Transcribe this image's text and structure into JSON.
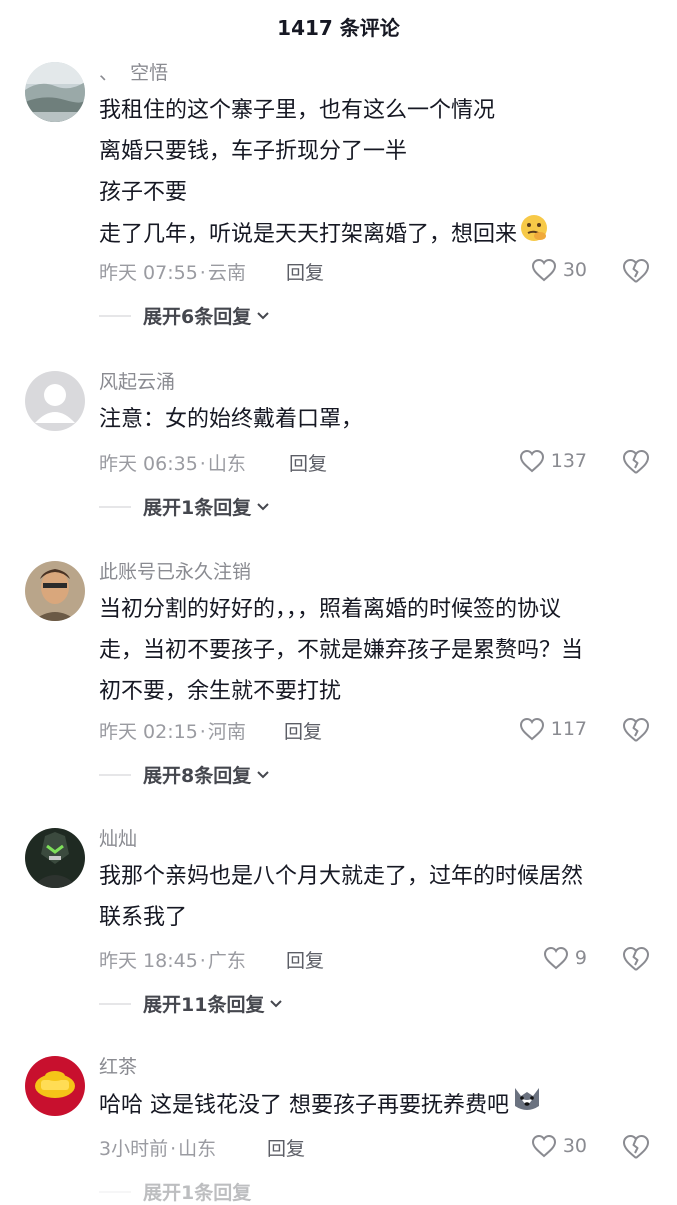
{
  "header": {
    "title": "1417 条评论"
  },
  "comments": [
    {
      "username": "、  空悟",
      "lines": [
        "我租住的这个寨子里，也有这么一个情况",
        "离婚只要钱，车子折现分了一半",
        "孩子不要",
        "走了几年，听说是天天打架离婚了，想回来"
      ],
      "trailing_emoji": "thinking-face-emoji",
      "time": "昨天 07:55",
      "location": "云南",
      "reply_label": "回复",
      "likes": "30",
      "expand_label": "展开6条回复"
    },
    {
      "username": "风起云涌",
      "lines": [
        "注意：女的始终戴着口罩，"
      ],
      "time": "昨天 06:35",
      "location": "山东",
      "reply_label": "回复",
      "likes": "137",
      "expand_label": "展开1条回复"
    },
    {
      "username": "此账号已永久注销",
      "lines": [
        "当初分割的好好的，，，照着离婚的时候签的协议",
        "走，当初不要孩子，不就是嫌弃孩子是累赘吗？当",
        "初不要，余生就不要打扰"
      ],
      "time": "昨天 02:15",
      "location": "河南",
      "reply_label": "回复",
      "likes": "117",
      "expand_label": "展开8条回复"
    },
    {
      "username": "灿灿",
      "lines": [
        "我那个亲妈也是八个月大就走了，过年的时候居然",
        "联系我了"
      ],
      "time": "昨天 18:45",
      "location": "广东",
      "reply_label": "回复",
      "likes": "9",
      "expand_label": "展开11条回复"
    },
    {
      "username": "红茶",
      "lines": [
        "哈哈 这是钱花没了 想要孩子再要抚养费吧"
      ],
      "trailing_emoji": "husky-dog-emoji",
      "time": "3小时前",
      "location": "山东",
      "reply_label": "回复",
      "likes": "30",
      "expand_label": "展开1条回复"
    }
  ]
}
